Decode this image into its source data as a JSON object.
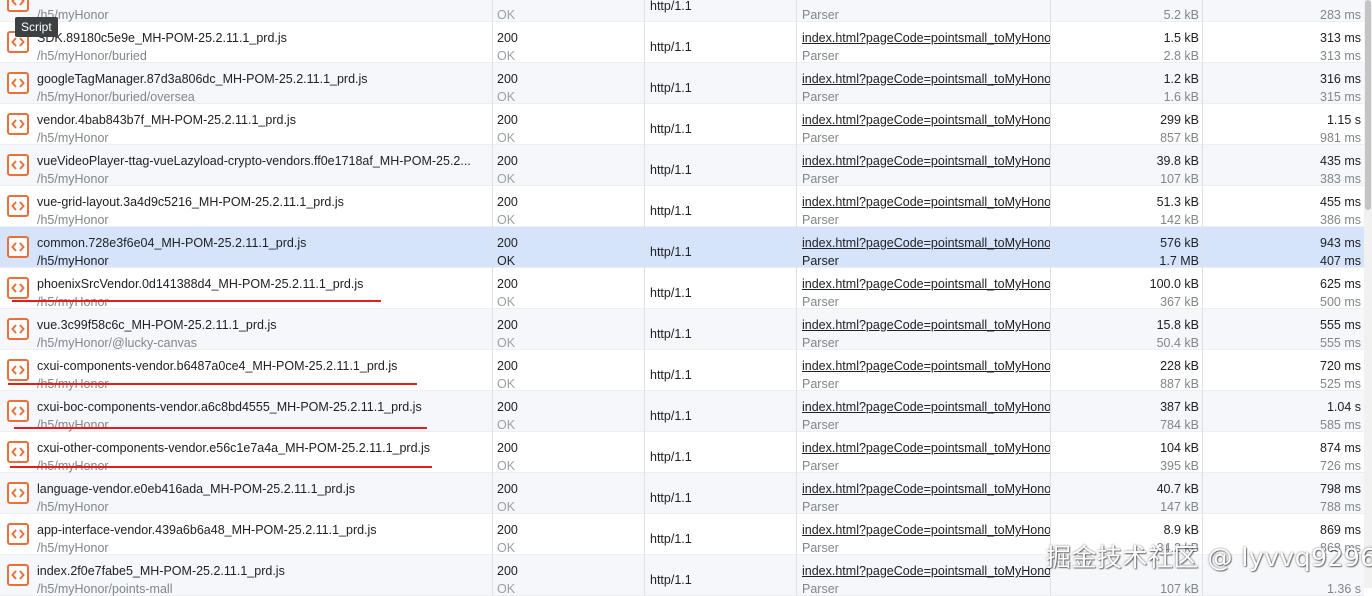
{
  "tooltip": "Script",
  "watermark": "掘金技术社区 @ lyvvq9296.",
  "colors": {
    "script_icon": "#e8703a",
    "selected_row": "#d6e4fb",
    "annotation": "#e02020"
  },
  "rows": [
    {
      "name": "",
      "path": "/h5/myHonor",
      "status": "",
      "status_text": "OK",
      "protocol": "http/1.1",
      "initiator": "",
      "initiator_type": "Parser",
      "size": "",
      "size2": "5.2 kB",
      "time": "",
      "time2": "283 ms"
    },
    {
      "name": "SDK.89180c5e9e_MH-POM-25.2.11.1_prd.js",
      "path": "/h5/myHonor/buried",
      "status": "200",
      "status_text": "OK",
      "protocol": "http/1.1",
      "initiator": "index.html?pageCode=pointsmall_toMyHonor",
      "initiator_type": "Parser",
      "size": "1.5 kB",
      "size2": "2.8 kB",
      "time": "313 ms",
      "time2": "313 ms"
    },
    {
      "name": "googleTagManager.87d3a806dc_MH-POM-25.2.11.1_prd.js",
      "path": "/h5/myHonor/buried/oversea",
      "status": "200",
      "status_text": "OK",
      "protocol": "http/1.1",
      "initiator": "index.html?pageCode=pointsmall_toMyHonor",
      "initiator_type": "Parser",
      "size": "1.2 kB",
      "size2": "1.6 kB",
      "time": "316 ms",
      "time2": "315 ms"
    },
    {
      "name": "vendor.4bab843b7f_MH-POM-25.2.11.1_prd.js",
      "path": "/h5/myHonor",
      "status": "200",
      "status_text": "OK",
      "protocol": "http/1.1",
      "initiator": "index.html?pageCode=pointsmall_toMyHonor",
      "initiator_type": "Parser",
      "size": "299 kB",
      "size2": "857 kB",
      "time": "1.15 s",
      "time2": "981 ms"
    },
    {
      "name": "vueVideoPlayer-ttag-vueLazyload-crypto-vendors.ff0e1718af_MH-POM-25.2...",
      "path": "/h5/myHonor",
      "status": "200",
      "status_text": "OK",
      "protocol": "http/1.1",
      "initiator": "index.html?pageCode=pointsmall_toMyHonor",
      "initiator_type": "Parser",
      "size": "39.8 kB",
      "size2": "107 kB",
      "time": "435 ms",
      "time2": "383 ms"
    },
    {
      "name": "vue-grid-layout.3a4d9c5216_MH-POM-25.2.11.1_prd.js",
      "path": "/h5/myHonor",
      "status": "200",
      "status_text": "OK",
      "protocol": "http/1.1",
      "initiator": "index.html?pageCode=pointsmall_toMyHonor",
      "initiator_type": "Parser",
      "size": "51.3 kB",
      "size2": "142 kB",
      "time": "455 ms",
      "time2": "386 ms"
    },
    {
      "name": "common.728e3f6e04_MH-POM-25.2.11.1_prd.js",
      "path": "/h5/myHonor",
      "status": "200",
      "status_text": "OK",
      "protocol": "http/1.1",
      "initiator": "index.html?pageCode=pointsmall_toMyHonor",
      "initiator_type": "Parser",
      "size": "576 kB",
      "size2": "1.7 MB",
      "time": "943 ms",
      "time2": "407 ms",
      "selected": true
    },
    {
      "name": "phoenixSrcVendor.0d141388d4_MH-POM-25.2.11.1_prd.js",
      "path": "/h5/myHonor",
      "status": "200",
      "status_text": "OK",
      "protocol": "http/1.1",
      "initiator": "index.html?pageCode=pointsmall_toMyHonor",
      "initiator_type": "Parser",
      "size": "100.0 kB",
      "size2": "367 kB",
      "time": "625 ms",
      "time2": "500 ms"
    },
    {
      "name": "vue.3c99f58c6c_MH-POM-25.2.11.1_prd.js",
      "path": "/h5/myHonor/@lucky-canvas",
      "status": "200",
      "status_text": "OK",
      "protocol": "http/1.1",
      "initiator": "index.html?pageCode=pointsmall_toMyHonor",
      "initiator_type": "Parser",
      "size": "15.8 kB",
      "size2": "50.4 kB",
      "time": "555 ms",
      "time2": "555 ms"
    },
    {
      "name": "cxui-components-vendor.b6487a0ce4_MH-POM-25.2.11.1_prd.js",
      "path": "/h5/myHonor",
      "status": "200",
      "status_text": "OK",
      "protocol": "http/1.1",
      "initiator": "index.html?pageCode=pointsmall_toMyHonor",
      "initiator_type": "Parser",
      "size": "228 kB",
      "size2": "887 kB",
      "time": "720 ms",
      "time2": "525 ms"
    },
    {
      "name": "cxui-boc-components-vendor.a6c8bd4555_MH-POM-25.2.11.1_prd.js",
      "path": "/h5/myHonor",
      "status": "200",
      "status_text": "OK",
      "protocol": "http/1.1",
      "initiator": "index.html?pageCode=pointsmall_toMyHonor",
      "initiator_type": "Parser",
      "size": "387 kB",
      "size2": "784 kB",
      "time": "1.04 s",
      "time2": "585 ms"
    },
    {
      "name": "cxui-other-components-vendor.e56c1e7a4a_MH-POM-25.2.11.1_prd.js",
      "path": "/h5/myHonor",
      "status": "200",
      "status_text": "OK",
      "protocol": "http/1.1",
      "initiator": "index.html?pageCode=pointsmall_toMyHonor",
      "initiator_type": "Parser",
      "size": "104 kB",
      "size2": "395 kB",
      "time": "874 ms",
      "time2": "726 ms"
    },
    {
      "name": "language-vendor.e0eb416ada_MH-POM-25.2.11.1_prd.js",
      "path": "/h5/myHonor",
      "status": "200",
      "status_text": "OK",
      "protocol": "http/1.1",
      "initiator": "index.html?pageCode=pointsmall_toMyHonor",
      "initiator_type": "Parser",
      "size": "40.7 kB",
      "size2": "147 kB",
      "time": "798 ms",
      "time2": "788 ms"
    },
    {
      "name": "app-interface-vendor.439a6b6a48_MH-POM-25.2.11.1_prd.js",
      "path": "/h5/myHonor",
      "status": "200",
      "status_text": "OK",
      "protocol": "http/1.1",
      "initiator": "index.html?pageCode=pointsmall_toMyHonor",
      "initiator_type": "Parser",
      "size": "8.9 kB",
      "size2": "34.2 kB",
      "time": "869 ms",
      "time2": "868 ms"
    },
    {
      "name": "index.2f0e7fabe5_MH-POM-25.2.11.1_prd.js",
      "path": "/h5/myHonor/points-mall",
      "status": "200",
      "status_text": "OK",
      "protocol": "http/1.1",
      "initiator": "index.html?pageCode=pointsmall_toMyHonor",
      "initiator_type": "Parser",
      "size": "",
      "size2": "107 kB",
      "time": "",
      "time2": "1.36 s"
    }
  ]
}
